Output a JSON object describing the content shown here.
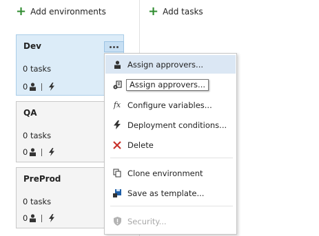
{
  "toolbar": {
    "add_environments_label": "Add environments",
    "add_tasks_label": "Add tasks"
  },
  "environments": [
    {
      "name": "Dev",
      "tasks": "0 tasks",
      "approvers": "0",
      "selected": true
    },
    {
      "name": "QA",
      "tasks": "0 tasks",
      "approvers": "0",
      "selected": false
    },
    {
      "name": "PreProd",
      "tasks": "0 tasks",
      "approvers": "0",
      "selected": false
    }
  ],
  "context_menu": {
    "items": [
      {
        "label": "Assign approvers...",
        "icon": "person-icon",
        "highlighted": true
      },
      {
        "label": "",
        "icon": "gear-agent-icon"
      },
      {
        "label": "Configure variables...",
        "icon": "fx-icon"
      },
      {
        "label": "Deployment conditions...",
        "icon": "lightning-icon"
      },
      {
        "label": "Delete",
        "icon": "delete-x-icon"
      },
      {
        "label": "Clone environment",
        "icon": "clone-icon"
      },
      {
        "label": "Save as template...",
        "icon": "save-icon"
      },
      {
        "label": "Security...",
        "icon": "shield-icon",
        "disabled": true
      }
    ]
  },
  "tooltip": {
    "text": "Assign approvers..."
  },
  "colors": {
    "accent_green": "#2e8b2e",
    "selected_card": "#dcecf8",
    "menu_highlight": "#dbe7f4",
    "delete_red": "#c8312b"
  }
}
